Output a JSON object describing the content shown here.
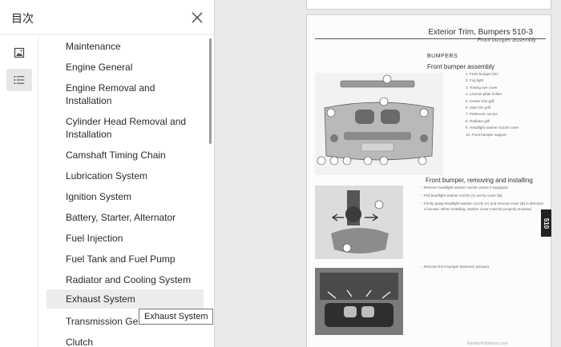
{
  "panel": {
    "title": "目次",
    "close_icon": "close-icon",
    "rail": [
      {
        "icon": "image-thumbnails-icon"
      },
      {
        "icon": "list-outline-icon",
        "selected": true
      }
    ],
    "toc_items": [
      {
        "label": "Maintenance"
      },
      {
        "label": "Engine General"
      },
      {
        "label": "Engine Removal and Installation"
      },
      {
        "label": "Cylinder Head Removal and Installation"
      },
      {
        "label": "Camshaft Timing Chain"
      },
      {
        "label": "Lubrication System"
      },
      {
        "label": "Ignition System"
      },
      {
        "label": "Battery, Starter, Alternator"
      },
      {
        "label": "Fuel Injection"
      },
      {
        "label": "Fuel Tank and Fuel Pump"
      },
      {
        "label": "Radiator and Cooling System"
      },
      {
        "label": "Exhaust System",
        "hovered": true
      },
      {
        "label": "Transmission General"
      },
      {
        "label": "Clutch"
      }
    ],
    "tooltip": "Exhaust System"
  },
  "document": {
    "header_title": "Exterior Trim, Bumpers    510-3",
    "sub_header": "Front bumper assembly",
    "section_title": "BUMPERS",
    "section_subtitle": "Front bumper assembly",
    "legend": [
      "1. Front bumper trim",
      "2. Fog light",
      "3. Towing eye cover",
      "4. License plate holder",
      "5. Center trim grill",
      "6. Side trim grill",
      "7. Parktronic sensor",
      "8. Radiator grill",
      "9. Headlight washer nozzle cover",
      "10. Front bumper support"
    ],
    "section2_title": "Front bumper, removing and installing",
    "bullets": [
      "Remove headlight washer nozzle covers if equipped.",
      "Pull headlight washer nozzle (A) out by cover (B).",
      "Firmly grasp headlight washer nozzle (A) and remove cover (B) in direction of arrows. When installing, washer cover must be properly encased."
    ],
    "step3": "Remove front bumper fasteners (arrows).",
    "footer": "BentleyPublishers.com",
    "side_tab": "510"
  }
}
